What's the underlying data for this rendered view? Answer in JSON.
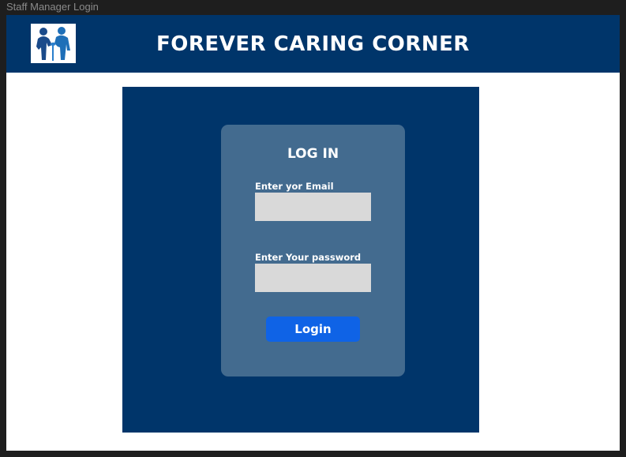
{
  "window": {
    "title": "Staff Manager Login"
  },
  "header": {
    "logo_icon": "caregiver-elder-logo-icon",
    "title": "FOREVER CARING CORNER"
  },
  "login_form": {
    "title": "LOG IN",
    "email_label": "Enter yor Email",
    "email_value": "",
    "password_label": "Enter Your password",
    "password_value": "",
    "submit_label": "Login"
  },
  "colors": {
    "header_background": "#00356a",
    "panel_background": "#00356a",
    "card_background": "#436b8f",
    "input_background": "#d9d9d9",
    "button_background": "#0f63e6",
    "page_background": "#ffffff"
  }
}
